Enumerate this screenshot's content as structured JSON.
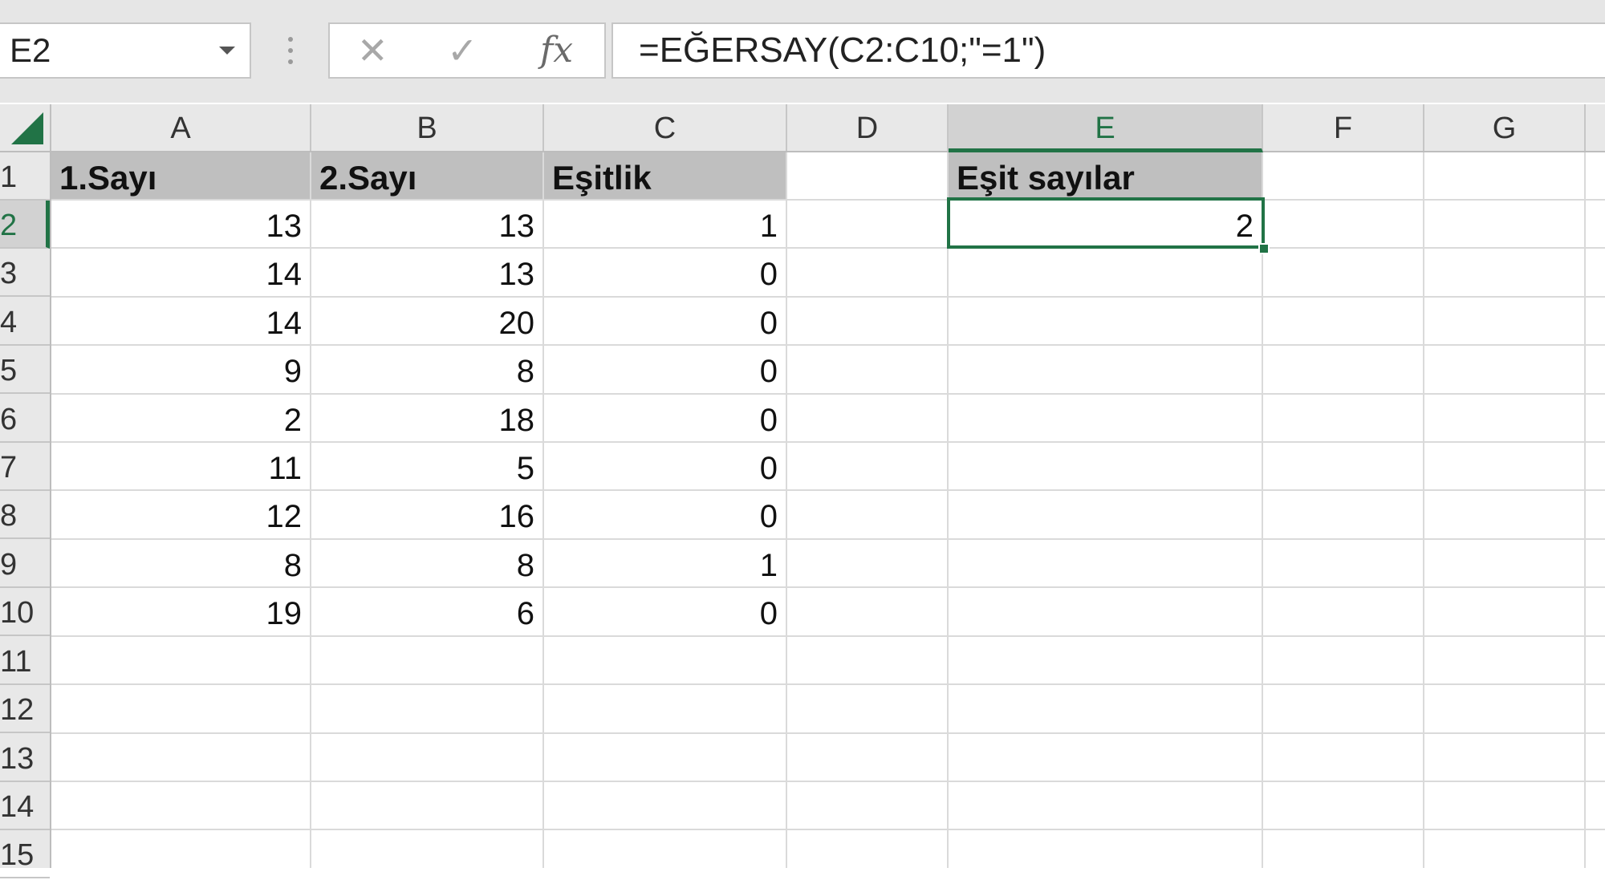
{
  "name_box": {
    "value": "E2"
  },
  "formula_bar": {
    "cancel_icon": "close-icon",
    "enter_icon": "check-icon",
    "fx_label": "fx",
    "formula": "=EĞERSAY(C2:C10;\"=1\")"
  },
  "columns": [
    "A",
    "B",
    "C",
    "D",
    "E",
    "F",
    "G"
  ],
  "rows": [
    "1",
    "2",
    "3",
    "4",
    "5",
    "6",
    "7",
    "8",
    "9",
    "10",
    "11",
    "12",
    "13",
    "14",
    "15"
  ],
  "selected_cell": "E2",
  "headers": {
    "a1": "1.Sayı",
    "b1": "2.Sayı",
    "c1": "Eşitlik",
    "e1": "Eşit sayılar"
  },
  "table": {
    "a": [
      "13",
      "14",
      "14",
      "9",
      "2",
      "11",
      "12",
      "8",
      "19"
    ],
    "b": [
      "13",
      "13",
      "20",
      "8",
      "18",
      "5",
      "16",
      "8",
      "6"
    ],
    "c": [
      "1",
      "0",
      "0",
      "0",
      "0",
      "0",
      "0",
      "1",
      "0"
    ]
  },
  "e2": "2",
  "colors": {
    "accent": "#217346",
    "header_fill": "#bfbfbf"
  }
}
